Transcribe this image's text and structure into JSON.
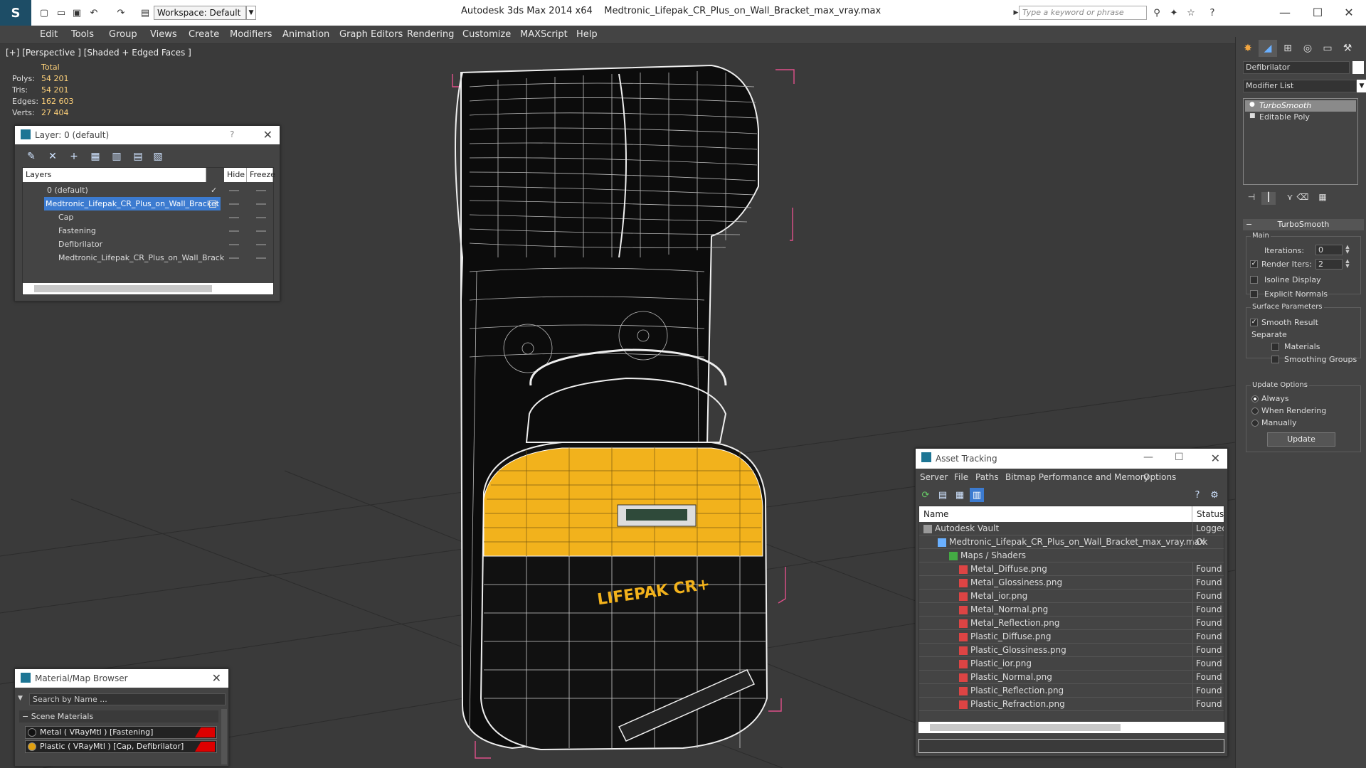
{
  "titlebar": {
    "workspace": "Workspace: Default",
    "app": "Autodesk 3ds Max  2014 x64",
    "file": "Medtronic_Lifepak_CR_Plus_on_Wall_Bracket_max_vray.max",
    "search_placeholder": "Type a keyword or phrase"
  },
  "menu": [
    "Edit",
    "Tools",
    "Group",
    "Views",
    "Create",
    "Modifiers",
    "Animation",
    "Graph Editors",
    "Rendering",
    "Customize",
    "MAXScript",
    "Help"
  ],
  "viewport": {
    "label": "[+] [Perspective ] [Shaded + Edged Faces ]",
    "stats_header": "Total",
    "stats": [
      {
        "label": "Polys:",
        "value": "54 201"
      },
      {
        "label": "Tris:",
        "value": "54 201"
      },
      {
        "label": "Edges:",
        "value": "162 603"
      },
      {
        "label": "Verts:",
        "value": "27 404"
      }
    ]
  },
  "layer_panel": {
    "title": "Layer: 0 (default)",
    "help": "?",
    "columns": [
      "Layers",
      "Hide",
      "Freeze"
    ],
    "rows": [
      {
        "name": "0 (default)"
      },
      {
        "name": "Medtronic_Lifepak_CR_Plus_on_Wall_Bracket"
      },
      {
        "name": "Cap"
      },
      {
        "name": "Fastening"
      },
      {
        "name": "Defibrilator"
      },
      {
        "name": "Medtronic_Lifepak_CR_Plus_on_Wall_Brack"
      }
    ]
  },
  "material_browser": {
    "title": "Material/Map Browser",
    "search_placeholder": "Search by Name ...",
    "section": "Scene Materials",
    "materials": [
      "Metal  ( VRayMtl )  [Fastening]",
      "Plastic  ( VRayMtl )  [Cap, Defibrilator]"
    ]
  },
  "asset_tracking": {
    "title": "Asset Tracking",
    "menu": [
      "Server",
      "File",
      "Paths",
      "Bitmap Performance and Memory",
      "Options"
    ],
    "columns": [
      "Name",
      "Status"
    ],
    "rows": [
      {
        "name": "Autodesk Vault",
        "status": "Logged"
      },
      {
        "name": "Medtronic_Lifepak_CR_Plus_on_Wall_Bracket_max_vray.max",
        "status": "Ok"
      },
      {
        "name": "Maps / Shaders",
        "status": ""
      },
      {
        "name": "Metal_Diffuse.png",
        "status": "Found"
      },
      {
        "name": "Metal_Glossiness.png",
        "status": "Found"
      },
      {
        "name": "Metal_ior.png",
        "status": "Found"
      },
      {
        "name": "Metal_Normal.png",
        "status": "Found"
      },
      {
        "name": "Metal_Reflection.png",
        "status": "Found"
      },
      {
        "name": "Plastic_Diffuse.png",
        "status": "Found"
      },
      {
        "name": "Plastic_Glossiness.png",
        "status": "Found"
      },
      {
        "name": "Plastic_ior.png",
        "status": "Found"
      },
      {
        "name": "Plastic_Normal.png",
        "status": "Found"
      },
      {
        "name": "Plastic_Reflection.png",
        "status": "Found"
      },
      {
        "name": "Plastic_Refraction.png",
        "status": "Found"
      }
    ]
  },
  "command_panel": {
    "object_name": "Defibrilator",
    "modifier_list": "Modifier List",
    "stack": [
      "TurboSmooth",
      "Editable Poly"
    ],
    "turbosmooth": {
      "title": "TurboSmooth",
      "main": "Main",
      "iterations_label": "Iterations:",
      "iterations": "0",
      "render_iters_label": "Render Iters:",
      "render_iters": "2",
      "isoline": "Isoline Display",
      "explicit": "Explicit Normals",
      "surface": "Surface Parameters",
      "smooth_result": "Smooth Result",
      "separate": "Separate",
      "materials": "Materials",
      "smoothing_groups": "Smoothing Groups",
      "update_options": "Update Options",
      "always": "Always",
      "when_rendering": "When Rendering",
      "manually": "Manually",
      "update": "Update"
    }
  },
  "colors": {
    "accent_yellow": "#f2b21c",
    "selection_blue": "#3c7bd0",
    "stats_value": "#ffd27a",
    "bounding_box": "#e0508a"
  }
}
